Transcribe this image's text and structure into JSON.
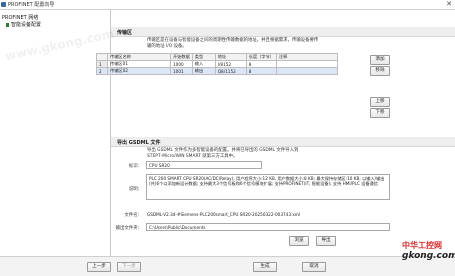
{
  "window": {
    "title": "PROFINET 配置向导",
    "close_glyph": "✕"
  },
  "tree": {
    "root": "PROFINET 网络",
    "child": "智能设备配置"
  },
  "transfer": {
    "header": "传输区",
    "desc_line1": "传输区是在设备与智能设备之间的周期性传输数据的地址。并且根据需求，传输设备要传",
    "desc_line2": "输的地址 I/O 设备。",
    "columns": [
      "",
      "传输区名称",
      "开始数据",
      "类型",
      "地址",
      "长度（字节）",
      "注释"
    ],
    "rows": [
      [
        "1",
        "传输区01",
        "1000",
        "输入",
        "I/8152",
        "8",
        ""
      ],
      [
        "2",
        "传输区02",
        "1001",
        "输出",
        "Q8/1152",
        "8",
        ""
      ]
    ]
  },
  "buttons": {
    "add": "添加",
    "remove": "移除",
    "up": "上移",
    "down": "下移",
    "browse": "浏览",
    "export": "导出"
  },
  "export": {
    "header": "导出 GSDML 文件",
    "desc_line1": "导出 GSDML 文件作为多智能设备的配置。并将已导出的 GSDML 文件导入到",
    "desc_line2": "STEP7-Micro/WIN SMART 就第三方工具中。",
    "id_label": "标识：",
    "id_value": "CPU SR20",
    "desc_label": "说明：",
    "desc_value": "PLC 200 SMART CPU SR20(AC/DC/Relay); 用户程序大小:12 KB, 用户数据大小:8 KB; 最大保持存储区:10 KB; 以输入/输出(共)6个以添加新设计数据; 支持最大3个信号板和6个信号模块扩展; 支持PROFINET(IT, 智能设备); 支持 HMI/PLC 设备通信",
    "file_label": "文件名：",
    "file_value": "GSDML-V2.34-#Siemens-PLC200smart_CPU SR20-20250322-003743.xml",
    "folder_label": "输出文件夹：",
    "folder_value": "C:\\Users\\Public\\Documents"
  },
  "footer": {
    "prev": "上一步",
    "next": "下一步",
    "generate": "生成",
    "cancel": "取消"
  },
  "watermark": {
    "text": "中华工控网",
    "url": "gkong.com",
    "left": "www.gkong.com"
  },
  "colors": {
    "selection": "#dbe7f6",
    "section_bg": "#eeeeee",
    "watermark": "#d62b2b"
  }
}
